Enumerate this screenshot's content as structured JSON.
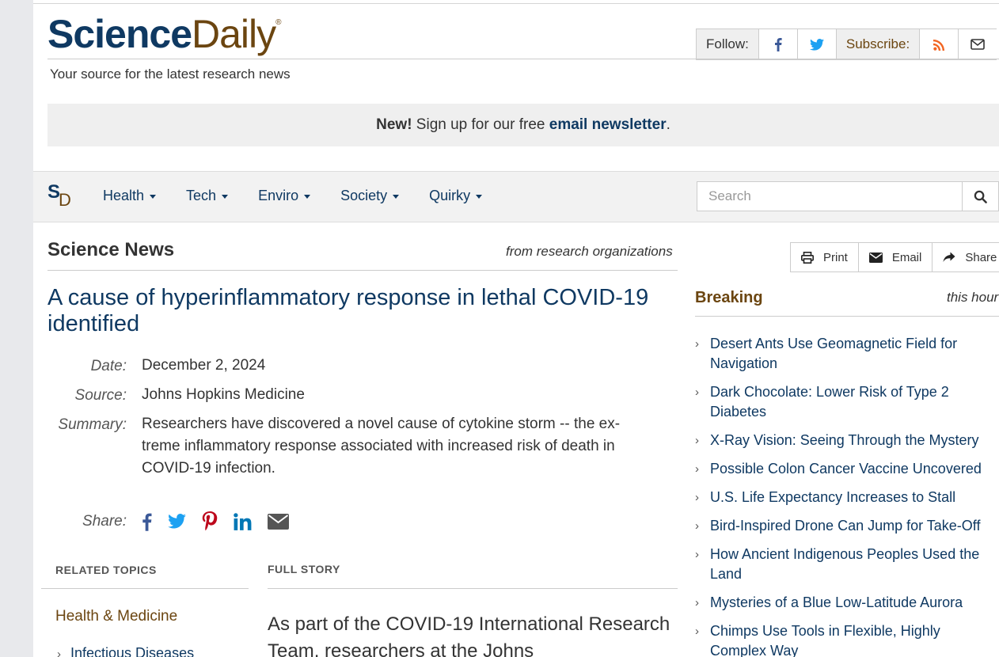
{
  "header": {
    "logo_science": "Science",
    "logo_daily": "Daily",
    "logo_reg": "®",
    "tagline": "Your source for the latest research news",
    "follow_label": "Follow:",
    "subscribe_label": "Subscribe:"
  },
  "newsletter": {
    "new_label": "New!",
    "text": " Sign up for our free ",
    "link": "email newsletter",
    "end": "."
  },
  "nav": {
    "logo_s": "S",
    "logo_d": "D",
    "items": [
      "Health",
      "Tech",
      "Enviro",
      "Society",
      "Quirky"
    ],
    "search_placeholder": "Search"
  },
  "article": {
    "section_title": "Science News",
    "from_label": "from research organizations",
    "headline": "A cause of hyperinflammatory response in lethal COVID-19 identified",
    "date_label": "Date:",
    "date": "December 2, 2024",
    "source_label": "Source:",
    "source": "Johns Hopkins Medicine",
    "summary_label": "Summary:",
    "summary": "Researchers have discovered a novel cause of cytokine storm -- the ex- treme inflammatory response associated with increased risk of death in COVID-19 infection.",
    "share_label": "Share:",
    "related_topics_label": "RELATED TOPICS",
    "full_story_label": "FULL STORY",
    "topic_category": "Health & Medicine",
    "topic_item": "Infectious Diseases",
    "story_start": "As part of the COVID-19 International Research Team, researchers at the Johns"
  },
  "tools": {
    "print": "Print",
    "email": "Email",
    "share": "Share"
  },
  "sidebar": {
    "breaking_label": "Breaking",
    "this_hour": "this hour",
    "items": [
      "Desert Ants Use Geomagnetic Field for Navigation",
      "Dark Chocolate: Lower Risk of Type 2 Diabetes",
      "X-Ray Vision: Seeing Through the Mystery",
      "Possible Colon Cancer Vaccine Uncovered",
      "U.S. Life Expectancy Increases to Stall",
      "Bird-Inspired Drone Can Jump for Take-Off",
      "How Ancient Indigenous Peoples Used the Land",
      "Mysteries of a Blue Low-Latitude Aurora",
      "Chimps Use Tools in Flexible, Highly Complex Way"
    ]
  },
  "colors": {
    "brand_blue": "#0f3962",
    "brand_brown": "#6b4510",
    "facebook": "#3b5998",
    "twitter": "#1da1f2",
    "pinterest": "#bd081c",
    "linkedin": "#0077b5",
    "rss": "#f26522"
  }
}
